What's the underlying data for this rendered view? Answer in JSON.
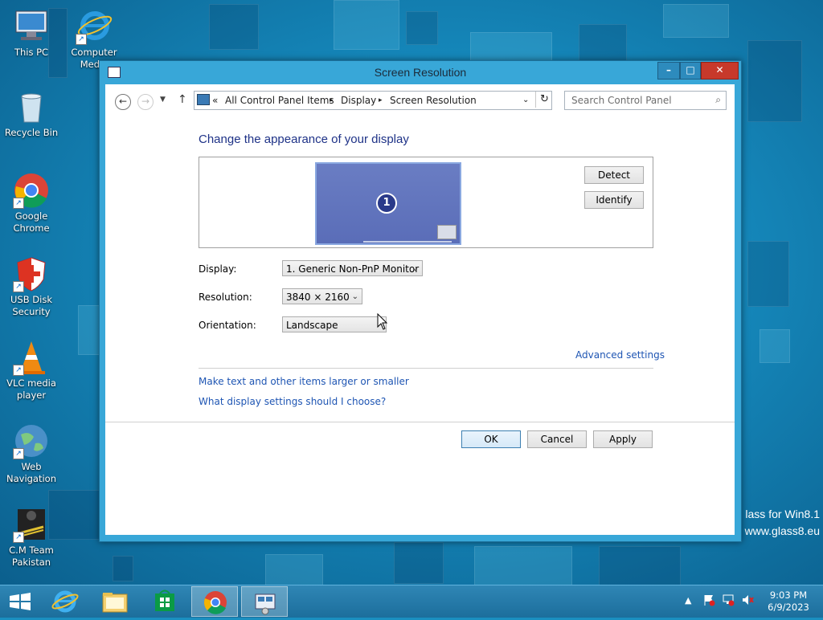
{
  "desktop": {
    "icons": [
      {
        "label": "This PC"
      },
      {
        "label": "Computer Media"
      },
      {
        "label": "Recycle Bin"
      },
      {
        "label": "Google Chrome"
      },
      {
        "label": "USB Disk Security"
      },
      {
        "label": "VLC media player"
      },
      {
        "label": "Web Navigation"
      },
      {
        "label": "C.M Team Pakistan"
      }
    ],
    "watermark": {
      "line1": "lass for Win8.1",
      "line2": "www.glass8.eu"
    }
  },
  "window": {
    "title": "Screen Resolution",
    "address": {
      "prefix": "«",
      "crumbs": [
        "All Control Panel Items",
        "Display",
        "Screen Resolution"
      ],
      "separator": "▸"
    },
    "search_placeholder": "Search Control Panel",
    "heading": "Change the appearance of your display",
    "monitor_number": "1",
    "detect_label": "Detect",
    "identify_label": "Identify",
    "fields": {
      "display_label": "Display:",
      "display_value": "1. Generic Non-PnP Monitor",
      "resolution_label": "Resolution:",
      "resolution_value": "3840 × 2160",
      "orientation_label": "Orientation:",
      "orientation_value": "Landscape"
    },
    "advanced_link": "Advanced settings",
    "links": [
      "Make text and other items larger or smaller",
      "What display settings should I choose?"
    ],
    "buttons": {
      "ok": "OK",
      "cancel": "Cancel",
      "apply": "Apply"
    }
  },
  "taskbar": {
    "clock_time": "9:03 PM",
    "clock_date": "6/9/2023"
  },
  "colors": {
    "accent": "#38a7d8",
    "link": "#1e55b3",
    "heading": "#1e3287",
    "close": "#c7392b"
  }
}
